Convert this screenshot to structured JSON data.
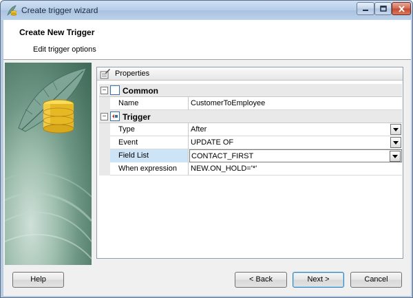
{
  "window": {
    "title": "Create trigger wizard"
  },
  "header": {
    "title": "Create New Trigger",
    "subtitle": "Edit trigger options"
  },
  "properties": {
    "panel_label": "Properties",
    "categories": [
      {
        "label": "Common",
        "toggle": "−",
        "rows": [
          {
            "name": "Name",
            "value": "CustomerToEmployee",
            "dropdown": false
          }
        ]
      },
      {
        "label": "Trigger",
        "toggle": "−",
        "rows": [
          {
            "name": "Type",
            "value": "After",
            "dropdown": true
          },
          {
            "name": "Event",
            "value": "UPDATE OF",
            "dropdown": true
          },
          {
            "name": "Field List",
            "value": "CONTACT_FIRST",
            "dropdown": true,
            "selected": true
          },
          {
            "name": "When expression",
            "value": "NEW.ON_HOLD='*'",
            "dropdown": false
          }
        ]
      }
    ]
  },
  "buttons": {
    "help": "Help",
    "back": "< Back",
    "next": "Next >",
    "cancel": "Cancel"
  },
  "icons": {
    "title": "feather-db-icon",
    "properties": "properties-icon",
    "common": "common-category-icon",
    "trigger": "trigger-category-icon",
    "sidebar": "database-feather-icon"
  },
  "colors": {
    "selection": "#cde4f7",
    "default_button_border": "#3c7fb1"
  }
}
